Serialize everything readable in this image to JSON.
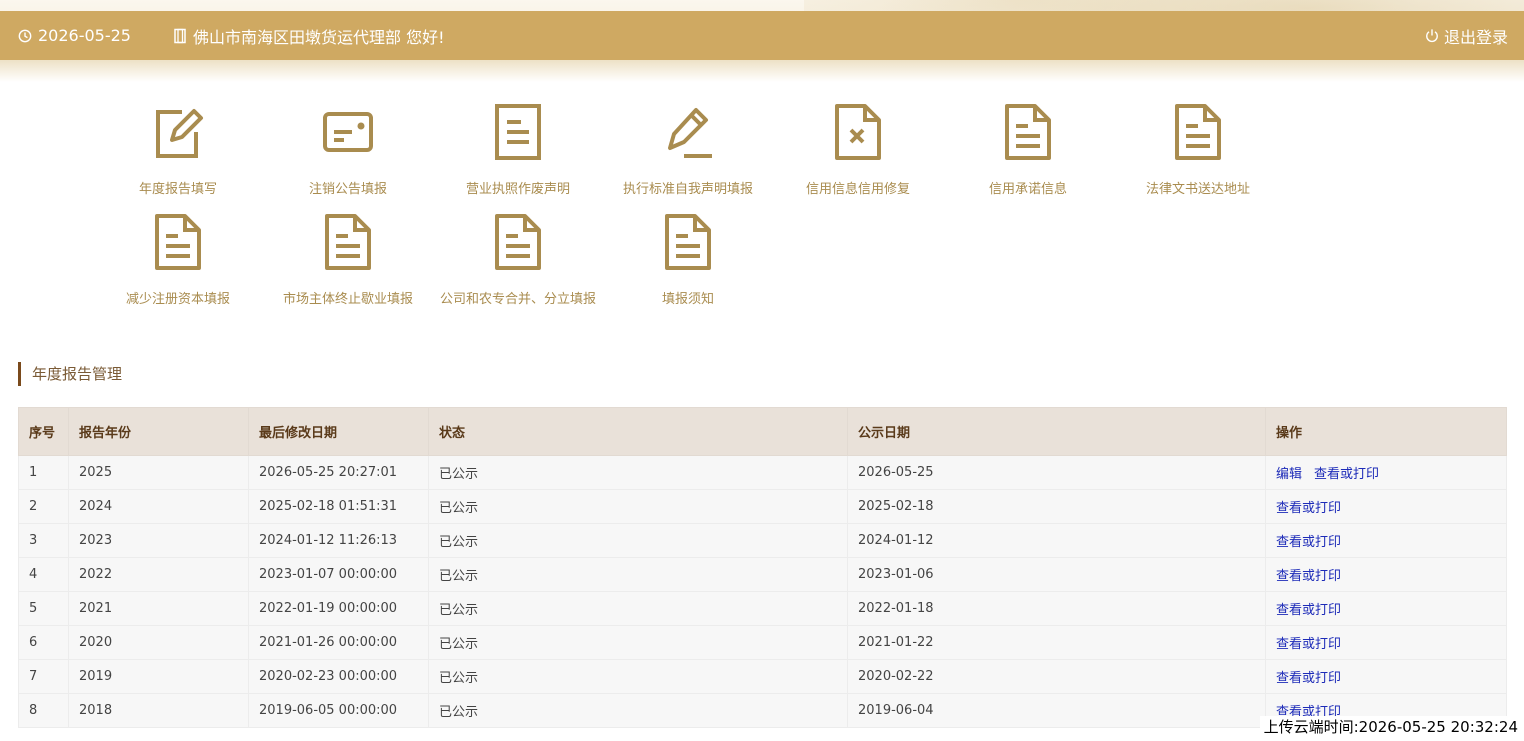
{
  "header": {
    "date": "2026-05-25",
    "greeting": "佛山市南海区田墩货运代理部 您好!",
    "logout_label": "退出登录",
    "bar_color": "#cfa962",
    "icons": {
      "date": "clock-icon",
      "greeting": "door-icon",
      "logout": "power-icon"
    }
  },
  "menu": {
    "icon_color": "#a98c4f",
    "items": [
      {
        "label": "年度报告填写",
        "icon": "edit-icon"
      },
      {
        "label": "注销公告填报",
        "icon": "card-icon"
      },
      {
        "label": "营业执照作废声明",
        "icon": "document-icon"
      },
      {
        "label": "执行标准自我声明填报",
        "icon": "pencil-icon"
      },
      {
        "label": "信用信息信用修复",
        "icon": "document-x-icon"
      },
      {
        "label": "信用承诺信息",
        "icon": "document-icon"
      },
      {
        "label": "法律文书送达地址",
        "icon": "document-icon"
      },
      {
        "label": "减少注册资本填报",
        "icon": "document-icon"
      },
      {
        "label": "市场主体终止歇业填报",
        "icon": "document-icon"
      },
      {
        "label": "公司和农专合并、分立填报",
        "icon": "document-icon"
      },
      {
        "label": "填报须知",
        "icon": "document-icon"
      }
    ]
  },
  "section": {
    "title": "年度报告管理"
  },
  "table": {
    "headers": [
      "序号",
      "报告年份",
      "最后修改日期",
      "状态",
      "公示日期",
      "操作"
    ],
    "rows": [
      {
        "no": "1",
        "year": "2025",
        "modified": "2026-05-25 20:27:01",
        "status": "已公示",
        "publish": "2026-05-25",
        "actions": [
          "编辑",
          "查看或打印"
        ]
      },
      {
        "no": "2",
        "year": "2024",
        "modified": "2025-02-18 01:51:31",
        "status": "已公示",
        "publish": "2025-02-18",
        "actions": [
          "查看或打印"
        ]
      },
      {
        "no": "3",
        "year": "2023",
        "modified": "2024-01-12 11:26:13",
        "status": "已公示",
        "publish": "2024-01-12",
        "actions": [
          "查看或打印"
        ]
      },
      {
        "no": "4",
        "year": "2022",
        "modified": "2023-01-07 00:00:00",
        "status": "已公示",
        "publish": "2023-01-06",
        "actions": [
          "查看或打印"
        ]
      },
      {
        "no": "5",
        "year": "2021",
        "modified": "2022-01-19 00:00:00",
        "status": "已公示",
        "publish": "2022-01-18",
        "actions": [
          "查看或打印"
        ]
      },
      {
        "no": "6",
        "year": "2020",
        "modified": "2021-01-26 00:00:00",
        "status": "已公示",
        "publish": "2021-01-22",
        "actions": [
          "查看或打印"
        ]
      },
      {
        "no": "7",
        "year": "2019",
        "modified": "2020-02-23 00:00:00",
        "status": "已公示",
        "publish": "2020-02-22",
        "actions": [
          "查看或打印"
        ]
      },
      {
        "no": "8",
        "year": "2018",
        "modified": "2019-06-05 00:00:00",
        "status": "已公示",
        "publish": "2019-06-04",
        "actions": [
          "查看或打印"
        ]
      }
    ]
  },
  "footer": {
    "upload_time": "上传云端时间:2026-05-25 20:32:24"
  }
}
